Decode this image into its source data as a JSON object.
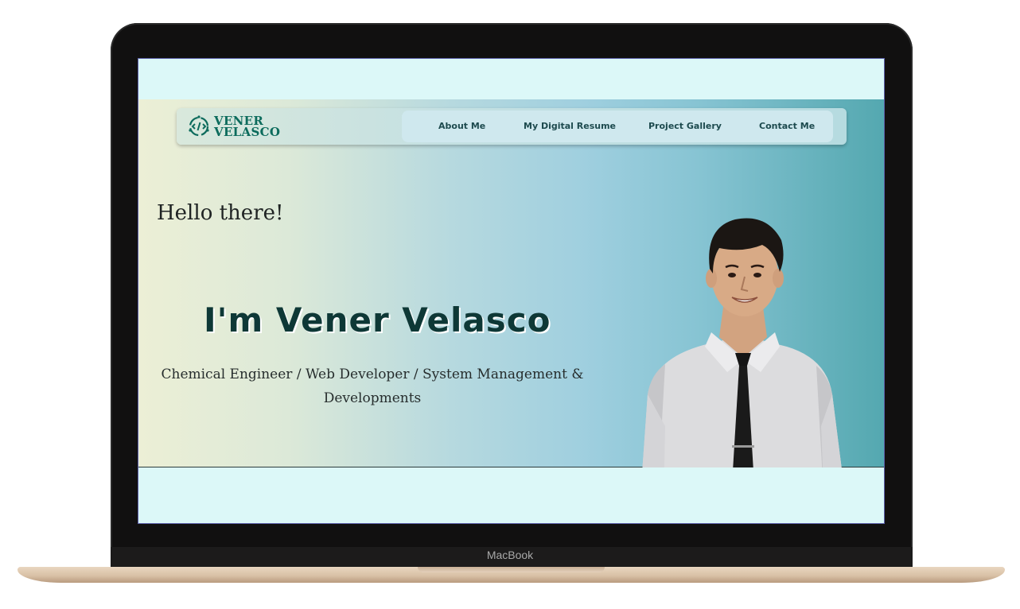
{
  "device": {
    "brand_label": "MacBook"
  },
  "site": {
    "logo": {
      "line1": "VENER",
      "line2": "VELASCO",
      "icon": "code-cycle-icon"
    },
    "nav": [
      {
        "label": "About Me"
      },
      {
        "label": "My Digital Resume"
      },
      {
        "label": "Project Gallery"
      },
      {
        "label": "Contact Me"
      }
    ],
    "hero": {
      "greeting": "Hello there!",
      "name": "I'm Vener Velasco",
      "roles_line1": "Chemical Engineer / Web Developer / System Management &",
      "roles_line2": "Developments",
      "portrait": "person-portrait-illustration"
    }
  },
  "colors": {
    "accent": "#0c6b5c",
    "name_text": "#0e3836",
    "page_band": "#dcf8f8",
    "hero_left": "#ecefd6",
    "hero_right": "#54a8b0"
  }
}
